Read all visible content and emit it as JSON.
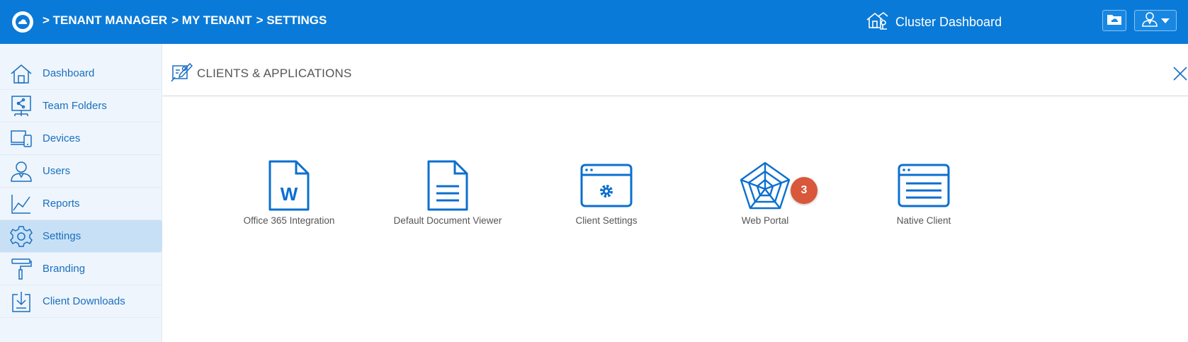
{
  "header": {
    "breadcrumb": [
      "> TENANT MANAGER",
      "> MY TENANT",
      "> SETTINGS"
    ],
    "cluster_dashboard_label": "Cluster Dashboard",
    "accent_color": "#0a7ad8"
  },
  "sidebar": {
    "items": [
      {
        "label": "Dashboard",
        "icon": "home-icon"
      },
      {
        "label": "Team Folders",
        "icon": "shared-folder-icon"
      },
      {
        "label": "Devices",
        "icon": "devices-icon"
      },
      {
        "label": "Users",
        "icon": "user-icon"
      },
      {
        "label": "Reports",
        "icon": "chart-icon"
      },
      {
        "label": "Settings",
        "icon": "gear-icon",
        "active": true
      },
      {
        "label": "Branding",
        "icon": "paint-roller-icon"
      },
      {
        "label": "Client Downloads",
        "icon": "download-icon"
      }
    ]
  },
  "panel": {
    "title": "CLIENTS & APPLICATIONS",
    "tiles": [
      {
        "label": "Office 365 Integration",
        "icon": "word-document-icon"
      },
      {
        "label": "Default Document Viewer",
        "icon": "document-icon"
      },
      {
        "label": "Client Settings",
        "icon": "browser-gear-icon"
      },
      {
        "label": "Web Portal",
        "icon": "web-icon"
      },
      {
        "label": "Native Client",
        "icon": "window-list-icon"
      }
    ],
    "badge": "3",
    "badge_color": "#d9573a"
  }
}
